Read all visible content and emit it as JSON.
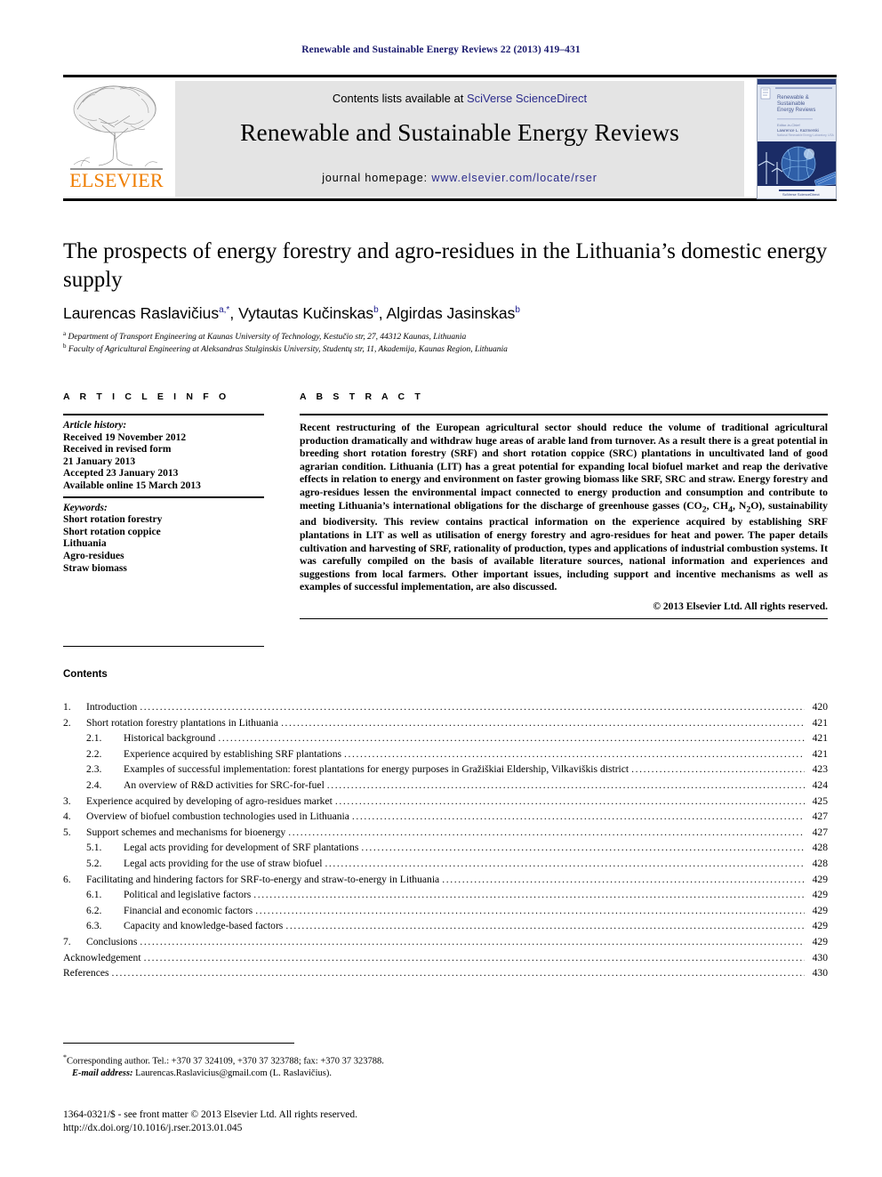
{
  "running_head": "Renewable and Sustainable Energy Reviews 22 (2013) 419–431",
  "masthead": {
    "publisher_name": "ELSEVIER",
    "contents_prefix": "Contents lists available at ",
    "contents_link": "SciVerse ScienceDirect",
    "journal_title": "Renewable and Sustainable Energy Reviews",
    "homepage_prefix": "journal homepage: ",
    "homepage_link": "www.elsevier.com/locate/rser",
    "cover_alt": "journal-cover-thumbnail",
    "link_color": "#2b2b8c",
    "band_color": "#e4e4e4",
    "elsevier_orange": "#ef7d00"
  },
  "article": {
    "title": "The prospects of energy forestry and agro-residues in the Lithuania’s domestic energy supply",
    "authors": [
      {
        "name": "Laurencas Raslavičius",
        "sup": "a,*"
      },
      {
        "name": "Vytautas Kučinskas",
        "sup": "b"
      },
      {
        "name": "Algirdas Jasinskas",
        "sup": "b"
      }
    ],
    "affiliations": [
      {
        "mark": "a",
        "text": "Department of Transport Engineering at Kaunas University of Technology, Kestučio str, 27, 44312 Kaunas, Lithuania"
      },
      {
        "mark": "b",
        "text": "Faculty of Agricultural Engineering at Aleksandras Stulginskis University, Studentų str, 11, Akademija, Kaunas Region, Lithuania"
      }
    ]
  },
  "article_info": {
    "heading": "A R T I C L E   I N F O",
    "history_label": "Article history:",
    "history": [
      "Received 19 November 2012",
      "Received in revised form",
      "21 January 2013",
      "Accepted 23 January 2013",
      "Available online 15 March 2013"
    ],
    "keywords_label": "Keywords:",
    "keywords": [
      "Short rotation forestry",
      "Short rotation coppice",
      "Lithuania",
      "Agro-residues",
      "Straw biomass"
    ]
  },
  "abstract": {
    "heading": "A B S T R A C T",
    "body": "Recent restructuring of the European agricultural sector should reduce the volume of traditional agricultural production dramatically and withdraw huge areas of arable land from turnover. As a result there is a great potential in breeding short rotation forestry (SRF) and short rotation coppice (SRC) plantations in uncultivated land of good agrarian condition. Lithuania (LIT) has a great potential for expanding local biofuel market and reap the derivative effects in relation to energy and environment on faster growing biomass like SRF, SRC and straw. Energy forestry and agro-residues lessen the environmental impact connected to energy production and consumption and contribute to meeting Lithuania’s international obligations for the discharge of greenhouse gasses (CO2, CH4, N2O), sustainability and biodiversity. This review contains practical information on the experience acquired by establishing SRF plantations in LIT as well as utilisation of energy forestry and agro-residues for heat and power. The paper details cultivation and harvesting of SRF, rationality of production, types and applications of industrial combustion systems. It was carefully compiled on the basis of available literature sources, national information and experiences and suggestions from local farmers. Other important issues, including support and incentive mechanisms as well as examples of successful implementation, are also discussed.",
    "copyright": "© 2013 Elsevier Ltd. All rights reserved."
  },
  "contents": {
    "heading": "Contents",
    "entries": [
      {
        "num": "1.",
        "level": 0,
        "label": "Introduction",
        "page": "420"
      },
      {
        "num": "2.",
        "level": 0,
        "label": "Short rotation forestry plantations in Lithuania",
        "page": "421"
      },
      {
        "num": "2.1.",
        "level": 1,
        "label": "Historical background",
        "page": "421"
      },
      {
        "num": "2.2.",
        "level": 1,
        "label": "Experience acquired by establishing SRF plantations",
        "page": "421"
      },
      {
        "num": "2.3.",
        "level": 1,
        "label": "Examples of successful implementation: forest plantations for energy purposes in Gražiškiai Eldership, Vilkaviškis district",
        "page": "423"
      },
      {
        "num": "2.4.",
        "level": 1,
        "label": "An overview of R&D activities for SRC-for-fuel",
        "page": "424"
      },
      {
        "num": "3.",
        "level": 0,
        "label": "Experience acquired by developing of agro-residues market",
        "page": "425"
      },
      {
        "num": "4.",
        "level": 0,
        "label": "Overview of biofuel combustion technologies used in Lithuania",
        "page": "427"
      },
      {
        "num": "5.",
        "level": 0,
        "label": "Support schemes and mechanisms for bioenergy",
        "page": "427"
      },
      {
        "num": "5.1.",
        "level": 1,
        "label": "Legal acts providing for development of SRF plantations",
        "page": "428"
      },
      {
        "num": "5.2.",
        "level": 1,
        "label": "Legal acts providing for the use of straw biofuel",
        "page": "428"
      },
      {
        "num": "6.",
        "level": 0,
        "label": "Facilitating and hindering factors for SRF-to-energy and straw-to-energy in Lithuania",
        "page": "429"
      },
      {
        "num": "6.1.",
        "level": 1,
        "label": "Political and legislative factors",
        "page": "429"
      },
      {
        "num": "6.2.",
        "level": 1,
        "label": "Financial and economic factors",
        "page": "429"
      },
      {
        "num": "6.3.",
        "level": 1,
        "label": "Capacity and knowledge-based factors",
        "page": "429"
      },
      {
        "num": "7.",
        "level": 0,
        "label": "Conclusions",
        "page": "429"
      },
      {
        "num": "",
        "level": 2,
        "label": "Acknowledgement",
        "page": "430"
      },
      {
        "num": "",
        "level": 2,
        "label": "References",
        "page": "430"
      }
    ]
  },
  "footer": {
    "corresponding_mark": "*",
    "corresponding": "Corresponding author. Tel.: +370 37 324109, +370 37 323788; fax: +370 37 323788.",
    "email_label": "E-mail address:",
    "email": "Laurencas.Raslavicius@gmail.com (L. Raslavičius).",
    "issn_line": "1364-0321/$ - see front matter © 2013 Elsevier Ltd. All rights reserved.",
    "doi_line": "http://dx.doi.org/10.1016/j.rser.2013.01.045"
  }
}
